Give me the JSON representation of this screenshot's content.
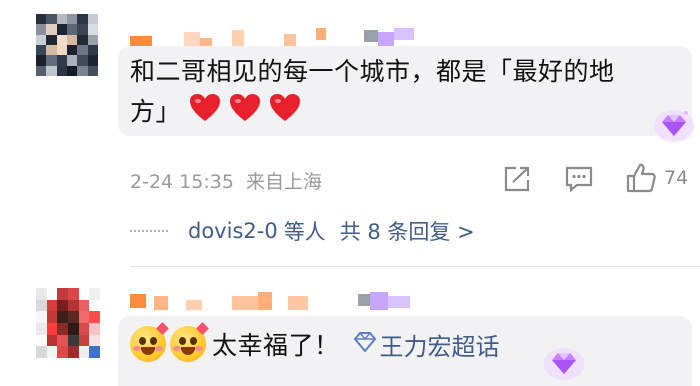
{
  "colors": {
    "heart": "#e8202c",
    "link": "#3f5d8a",
    "meta": "#9a9a9a",
    "topic_icon": "#5a7fc4",
    "badge": "#c77dff"
  },
  "comment1": {
    "text_line1": "和二哥相见的每一个城市，都是「最好的地",
    "text_line2": "方」",
    "hearts": [
      "heart-icon",
      "heart-icon",
      "heart-icon"
    ],
    "timestamp": "2-24 15:35",
    "location": "来自上海",
    "like_count": "74",
    "replies": {
      "user": "dovis2-0",
      "suffix": "等人",
      "summary": "共 8 条回复 >"
    }
  },
  "comment2": {
    "text": "太幸福了！",
    "topic": "王力宏超话"
  }
}
